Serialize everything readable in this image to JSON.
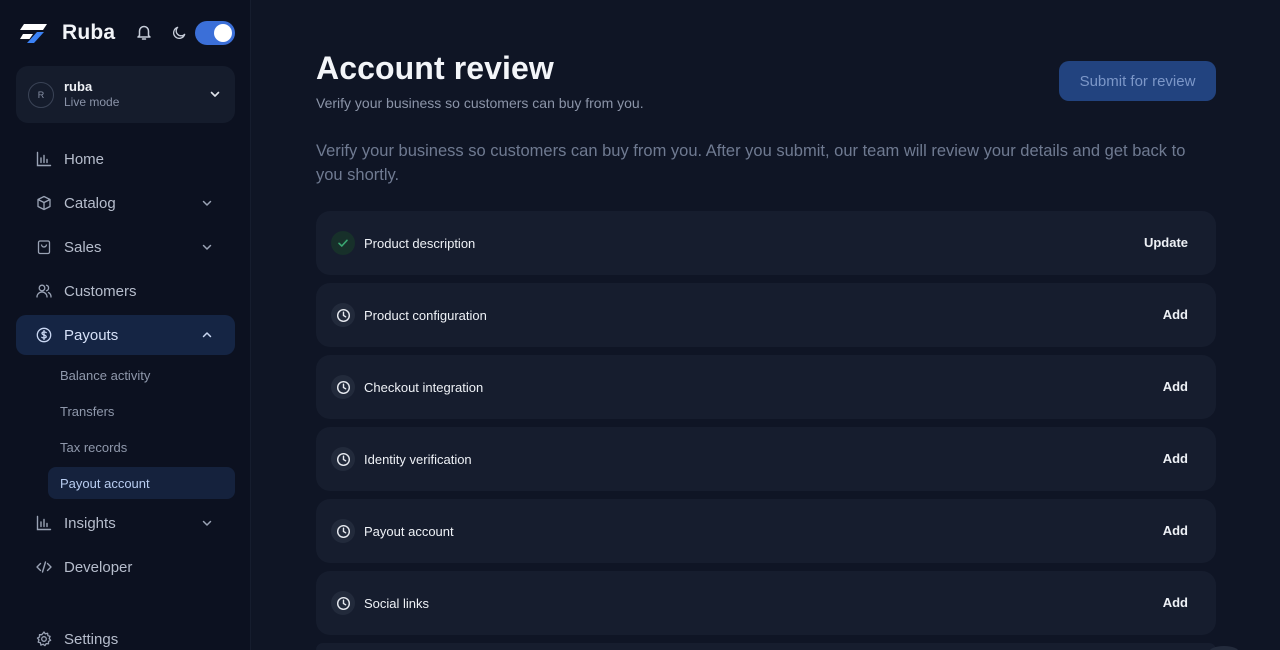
{
  "brand": {
    "name": "Ruba"
  },
  "account": {
    "initial": "R",
    "name": "ruba",
    "mode": "Live mode"
  },
  "theme": {
    "accent": "#3b6fd8",
    "success": "#3aa672",
    "background": "#0f1525"
  },
  "nav": {
    "home": "Home",
    "catalog": "Catalog",
    "sales": "Sales",
    "customers": "Customers",
    "payouts": "Payouts",
    "payouts_sub": {
      "balance_activity": "Balance activity",
      "transfers": "Transfers",
      "tax_records": "Tax records",
      "payout_account": "Payout account"
    },
    "insights": "Insights",
    "developer": "Developer",
    "settings": "Settings"
  },
  "page": {
    "title": "Account review",
    "subtitle": "Verify your business so customers can buy from you.",
    "submit_label": "Submit for review",
    "intro": "Verify your business so customers can buy from you. After you submit, our team will review your details and get back to you shortly."
  },
  "requirements": [
    {
      "label": "Product description",
      "action": "Update",
      "status": "complete",
      "icon": "check-icon"
    },
    {
      "label": "Product configuration",
      "action": "Add",
      "status": "pending",
      "icon": "clock-icon"
    },
    {
      "label": "Checkout integration",
      "action": "Add",
      "status": "pending",
      "icon": "clock-icon"
    },
    {
      "label": "Identity verification",
      "action": "Add",
      "status": "pending",
      "icon": "clock-icon"
    },
    {
      "label": "Payout account",
      "action": "Add",
      "status": "pending",
      "icon": "clock-icon"
    },
    {
      "label": "Social links",
      "action": "Add",
      "status": "pending",
      "icon": "clock-icon"
    }
  ]
}
